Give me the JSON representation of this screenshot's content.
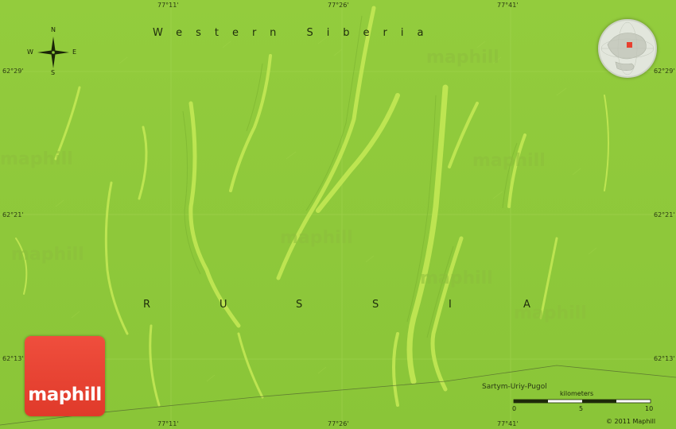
{
  "map": {
    "region_label": "Western Siberia",
    "country_letters": [
      "R",
      "U",
      "S",
      "S",
      "I",
      "A"
    ],
    "place_label": "Sartym-Uriy-Pugol",
    "brand": "maphill",
    "watermark_text": "maphill",
    "copyright": "© 2011 Maphill",
    "colors": {
      "terrain": "#8fc93a",
      "ridge": "#c8ec58",
      "logo": "#e8402f"
    }
  },
  "grid": {
    "longitudes": [
      "77°11'",
      "77°26'",
      "77°41'"
    ],
    "latitudes": [
      "62°29'",
      "62°21'",
      "62°13'"
    ]
  },
  "compass": {
    "n": "N",
    "s": "S",
    "e": "E",
    "w": "W"
  },
  "scale": {
    "unit": "kilometers",
    "ticks": [
      "0",
      "5",
      "10"
    ]
  },
  "globe": {
    "icon": "globe-icon"
  }
}
